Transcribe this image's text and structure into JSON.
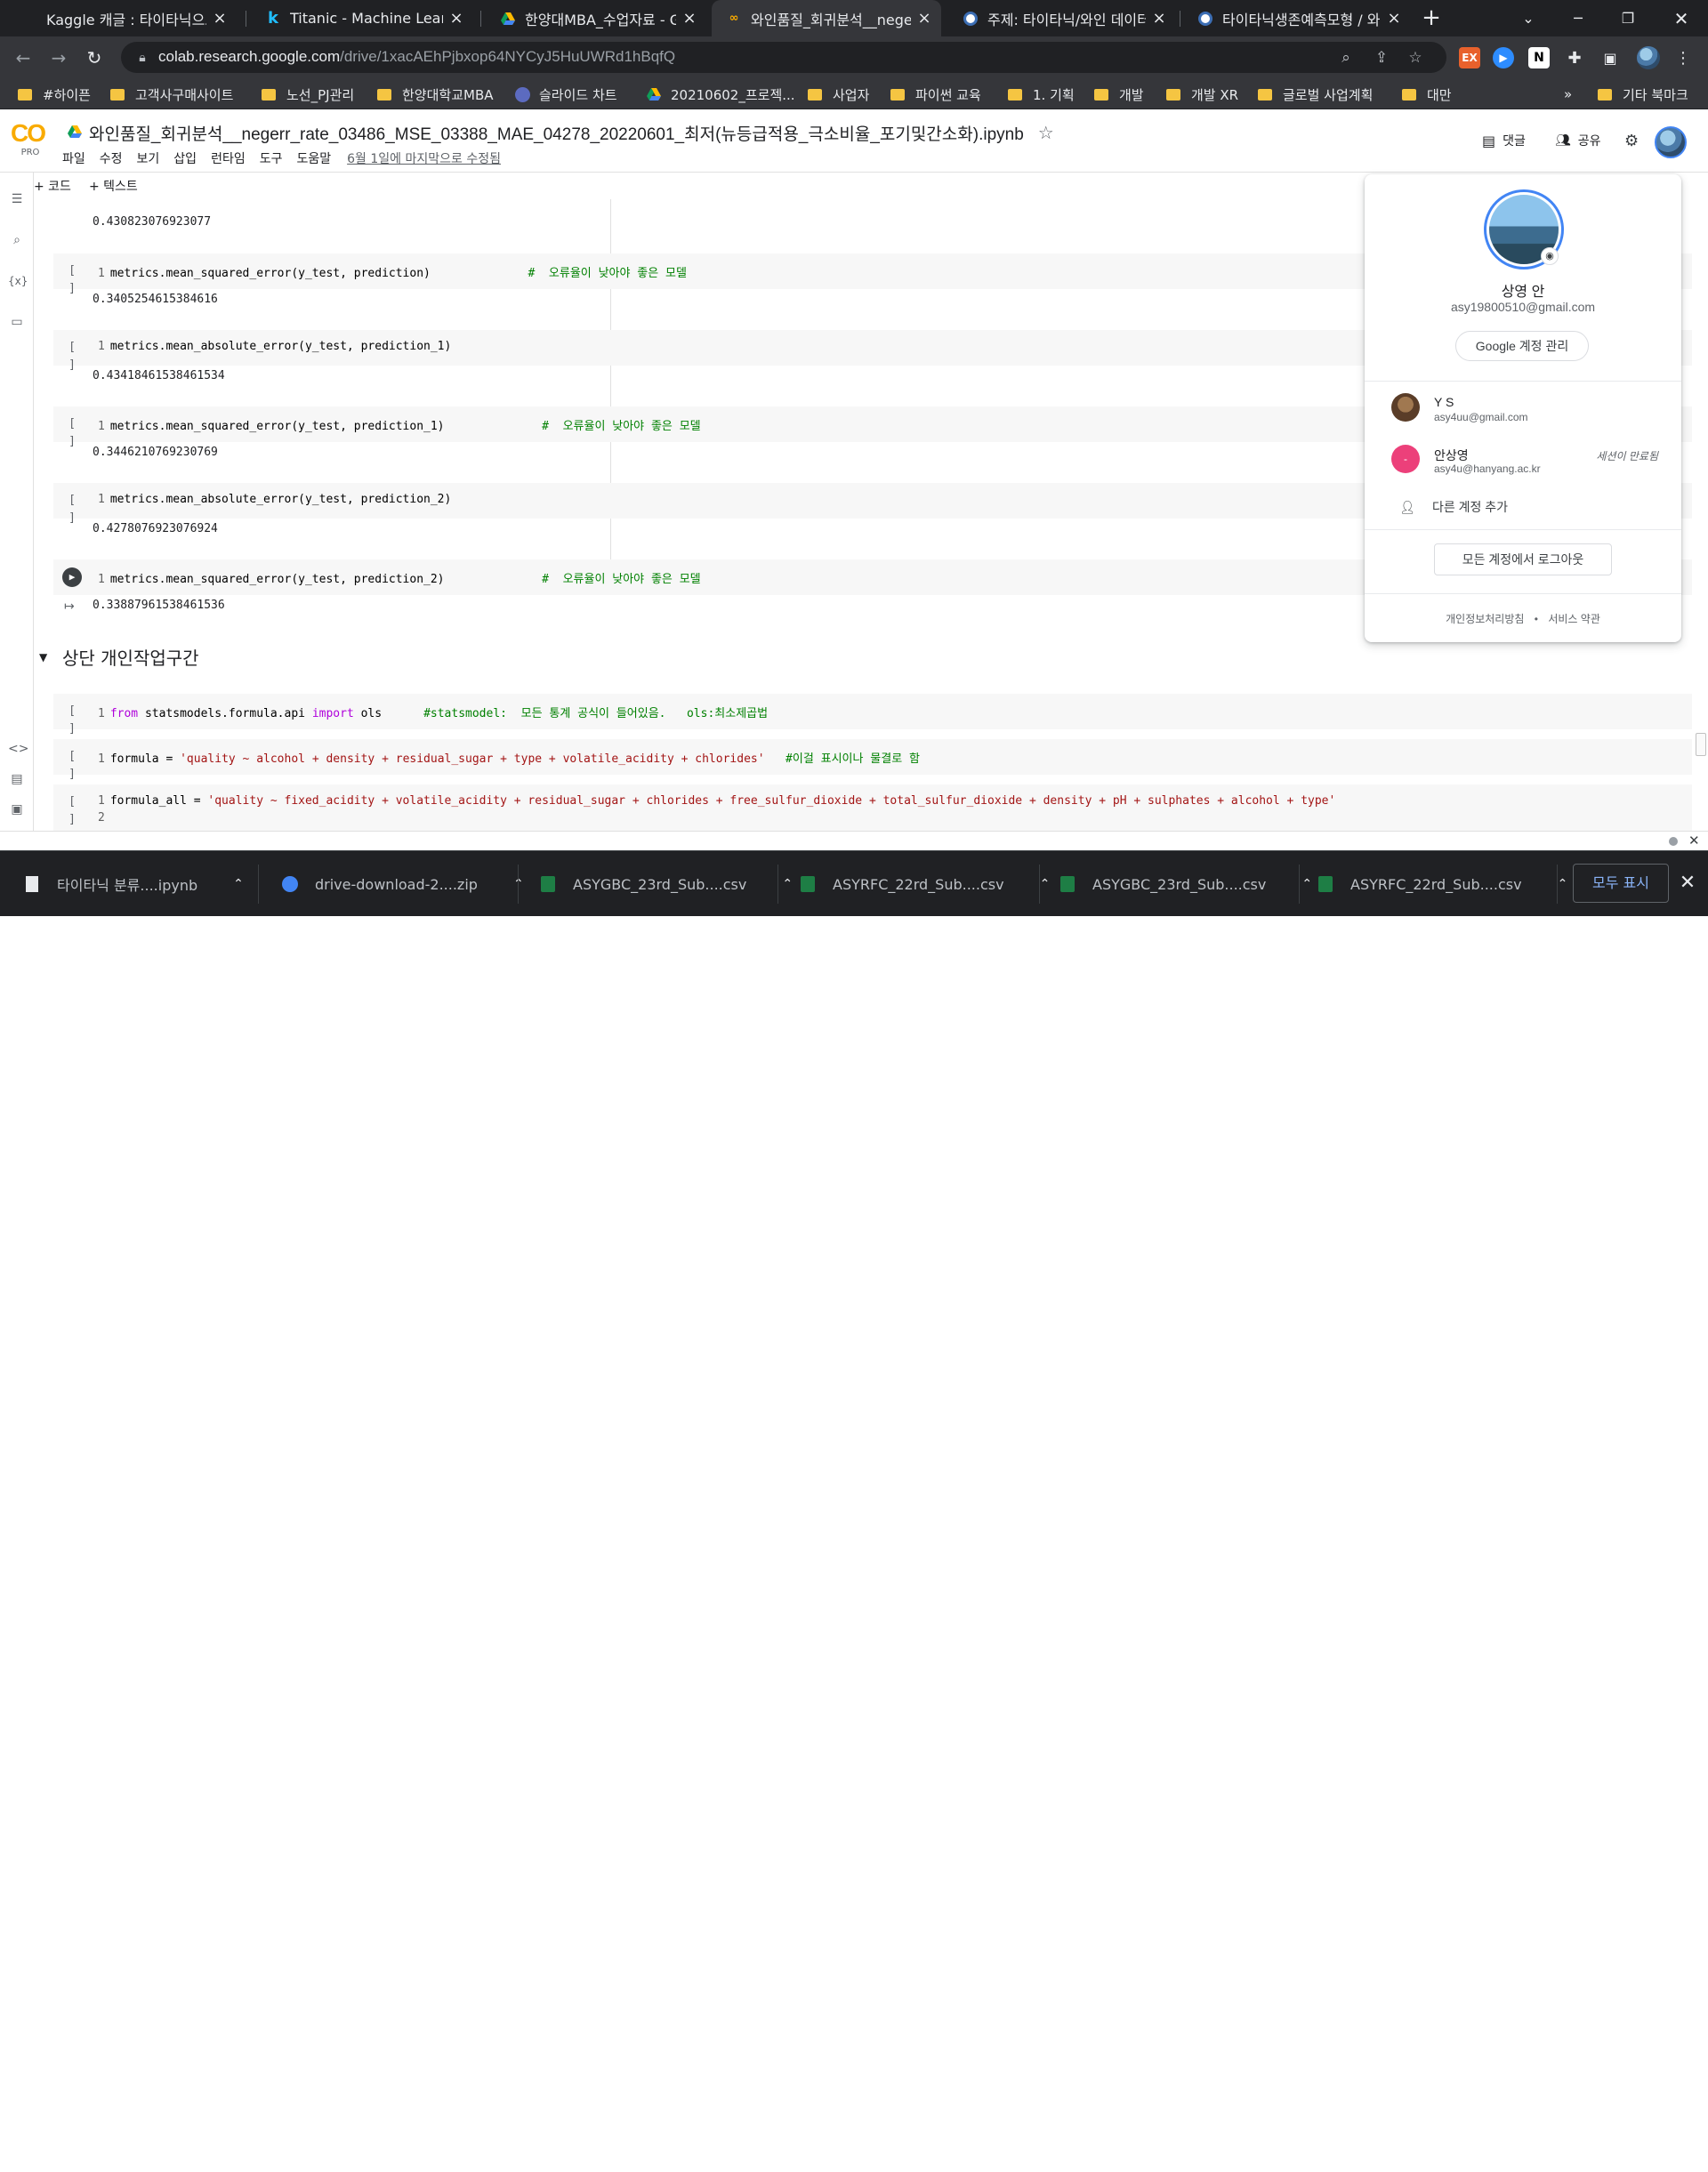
{
  "browser": {
    "tabs": [
      {
        "title": "Kaggle 캐글 : 타이타닉으로"
      },
      {
        "title": "Titanic - Machine Learning"
      },
      {
        "title": "한양대MBA_수업자료 - Go"
      },
      {
        "title": "와인품질_회귀분석__neger"
      },
      {
        "title": "주제: 타이타닉/와인 데이터"
      },
      {
        "title": "타이타닉생존예측모형 / 와"
      }
    ],
    "url_host": "colab.research.google.com",
    "url_path": "/drive/1xacAEhPjbxop64NYCyJ5HuUWRd1hBqfQ",
    "bookmarks": [
      "#하이픈",
      "고객사구매사이트",
      "노선_PJ관리",
      "한양대학교MBA",
      "슬라이드 차트",
      "20210602_프로젝...",
      "사업자",
      "파이썬 교육",
      "1. 기획",
      "개발",
      "개발 XR",
      "글로벌 사업계획",
      "대만"
    ],
    "bookmarks_more": "»",
    "bookmarks_other": "기타 북마크"
  },
  "colab": {
    "logo_text": "CO",
    "logo_sub": "PRO",
    "title": "와인품질_회귀분석__negerr_rate_03486_MSE_03388_MAE_04278_20220601_최저(뉴등급적용_극소비율_포기및간소화).ipynb",
    "menus": [
      "파일",
      "수정",
      "보기",
      "삽입",
      "런타임",
      "도구",
      "도움말"
    ],
    "last_saved": "6월 1일에 마지막으로 수정됨",
    "comment": "댓글",
    "share": "공유",
    "add_code": "+ 코드",
    "add_text": "+ 텍스트"
  },
  "notebook": {
    "outputs": [
      "0.4308230769230​77",
      "0.34052546153846​16",
      "0.43418461538461534",
      "0.3446210769230769",
      "0.4278076923076924",
      "0.33887961538461536"
    ],
    "cells": [
      {
        "run": "[ ]",
        "line": "1",
        "code": "metrics.mean_squared_error(y_test, prediction)",
        "comment": "#  오류율이 낮아야 좋은 모델"
      },
      {
        "run": "[ ]",
        "line": "1",
        "code": "metrics.mean_absolute_error(y_test, prediction_1)",
        "comment": ""
      },
      {
        "run": "[ ]",
        "line": "1",
        "code": "metrics.mean_squared_error(y_test, prediction_1)",
        "comment": "#  오류율이 낮아야 좋은 모델"
      },
      {
        "run": "[ ]",
        "line": "1",
        "code": "metrics.mean_absolute_error(y_test, prediction_2)",
        "comment": ""
      },
      {
        "run": "▶",
        "line": "1",
        "code": "metrics.mean_squared_error(y_test, prediction_2)",
        "comment": "#  오류율이 낮아야 좋은 모델"
      }
    ],
    "section_title": "상단 개인작업구간",
    "cell_ols": {
      "run": "[ ]",
      "line": "1",
      "kw_from": "from",
      "module": " statsmodels.formula.api ",
      "kw_import": "import",
      "name": " ols",
      "comment": "#statsmodel:  모든 통계 공식이 들어있음.   ols:최소제곱법"
    },
    "cell_formula": {
      "run": "[ ]",
      "line": "1",
      "lhs": "formula = ",
      "str": "'quality ~ alcohol + density + residual_sugar + type + volatile_acidity + chlorides'",
      "comment": "#이걸 표시이나 물결로 함"
    },
    "cell_formula_all": {
      "run": "[ ]",
      "line": "1",
      "line2": "2",
      "lhs": "formula_all = ",
      "str": "'quality ~ fixed_acidity + volatile_acidity + residual_sugar + chlorides + free_sulfur_dioxide + total_sulfur_dioxide + density + pH + sulphates + alcohol + type'"
    }
  },
  "account_popup": {
    "name": "상영 안",
    "email": "asy19800510@gmail.com",
    "manage": "Google 계정 관리",
    "accounts": [
      {
        "name": "Y S",
        "email": "asy4uu@gmail.com",
        "status": ""
      },
      {
        "name": "안상영",
        "email": "asy4u@hanyang.ac.kr",
        "status": "세션이 만료됨"
      }
    ],
    "add_account": "다른 계정 추가",
    "sign_out": "모든 계정에서 로그아웃",
    "privacy": "개인정보처리방침",
    "dot": "•",
    "terms": "서비스 약관"
  },
  "downloads": {
    "items": [
      "타이타닉 분류....ipynb",
      "drive-download-2....zip",
      "ASYGBC_23rd_Sub....csv",
      "ASYRFC_22rd_Sub....csv",
      "ASYGBC_23rd_Sub....csv",
      "ASYRFC_22rd_Sub....csv"
    ],
    "show_all": "모두 표시"
  },
  "colors": {
    "chrome_dark": "#202124",
    "chrome_mid": "#35363a",
    "comment_green": "#008000",
    "string_red": "#a31515",
    "keyword_purple": "#af00db",
    "link_blue": "#8ab4f8"
  }
}
